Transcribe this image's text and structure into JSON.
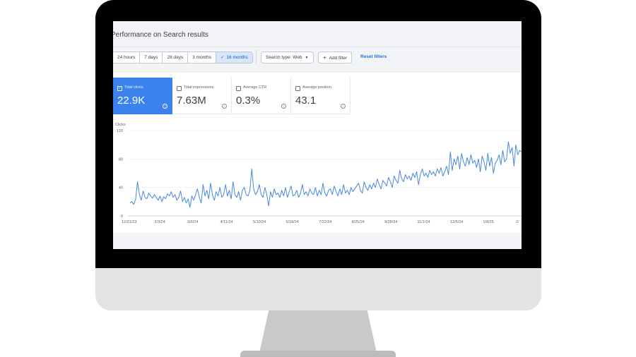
{
  "header": {
    "title": "Performance on Search results"
  },
  "date_range": {
    "options": [
      {
        "label": "24 hours"
      },
      {
        "label": "7 days"
      },
      {
        "label": "28 days"
      },
      {
        "label": "3 months"
      },
      {
        "label": "16 months",
        "selected": true
      }
    ]
  },
  "filters": {
    "search_type": "Search type: Web",
    "add_filter": "Add filter",
    "reset": "Reset filters"
  },
  "metrics": [
    {
      "label": "Total clicks",
      "value": "22.9K",
      "checked": true
    },
    {
      "label": "Total impressions",
      "value": "7.63M",
      "checked": false
    },
    {
      "label": "Average CTR",
      "value": "0.3%",
      "checked": false
    },
    {
      "label": "Average position",
      "value": "43.1",
      "checked": false
    }
  ],
  "colors": {
    "accent": "#3b82ec",
    "line": "#4a86e0",
    "selected_chip_bg": "#d7e7fb"
  },
  "chart_data": {
    "type": "line",
    "ylabel": "Clicks",
    "ylim": [
      0,
      120
    ],
    "yticks": [
      0,
      40,
      80,
      120
    ],
    "xtick_labels": [
      "12/31/23",
      "2/3/24",
      "3/6/24",
      "4/11/24",
      "5/10/24",
      "6/18/24",
      "7/22/24",
      "8/25/24",
      "9/28/24",
      "11/1/24",
      "12/5/24",
      "1/8/25",
      "2/"
    ],
    "grid": true,
    "series": [
      {
        "values": [
          18,
          20,
          16,
          24,
          48,
          30,
          22,
          35,
          26,
          24,
          32,
          28,
          25,
          30,
          26,
          22,
          28,
          20,
          27,
          24,
          31,
          28,
          34,
          26,
          30,
          22,
          26,
          35,
          20,
          26,
          18,
          24,
          12,
          28,
          22,
          30,
          38,
          26,
          18,
          44,
          28,
          36,
          24,
          46,
          30,
          22,
          34,
          28,
          40,
          26,
          30,
          44,
          28,
          36,
          24,
          48,
          30,
          26,
          34,
          22,
          36,
          40,
          30,
          28,
          36,
          66,
          38,
          30,
          34,
          44,
          30,
          26,
          40,
          30,
          14,
          34,
          26,
          38,
          30,
          32,
          26,
          36,
          28,
          40,
          26,
          34,
          42,
          28,
          30,
          36,
          26,
          32,
          44,
          30,
          34,
          28,
          38,
          32,
          30,
          40,
          28,
          36,
          30,
          46,
          32,
          28,
          36,
          38,
          30,
          42,
          34,
          28,
          38,
          30,
          44,
          32,
          36,
          30,
          40,
          34,
          38,
          42,
          46,
          36,
          32,
          48,
          40,
          36,
          44,
          38,
          46,
          40,
          52,
          44,
          38,
          50,
          46,
          42,
          54,
          48,
          40,
          56,
          50,
          46,
          64,
          52,
          48,
          58,
          52,
          56,
          50,
          60,
          54,
          62,
          44,
          58,
          66,
          56,
          60,
          54,
          64,
          58,
          62,
          56,
          66,
          60,
          68,
          56,
          62,
          70,
          58,
          90,
          64,
          80,
          72,
          84,
          66,
          88,
          76,
          70,
          82,
          72,
          86,
          74,
          78,
          68,
          80,
          62,
          84,
          76,
          64,
          88,
          70,
          82,
          60,
          74,
          78,
          86,
          72,
          92,
          76,
          80,
          104,
          88,
          96,
          70,
          100,
          86,
          92,
          90
        ]
      }
    ]
  }
}
